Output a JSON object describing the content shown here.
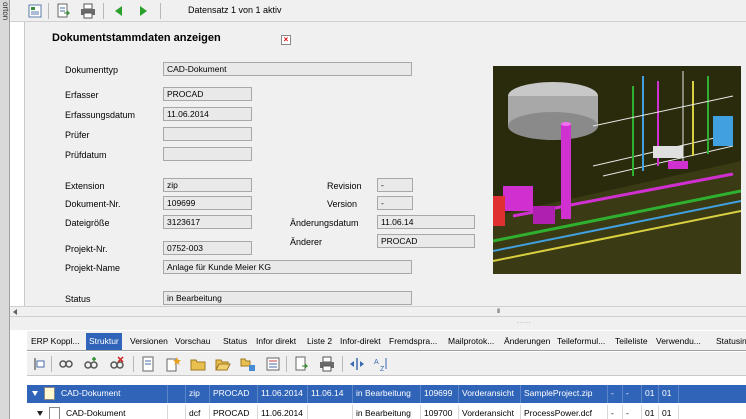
{
  "side_strip": {
    "label": "orton"
  },
  "toolbar": {
    "record_status": "Datensatz 1 von 1 aktiv",
    "icons": [
      "form-view-icon",
      "export-icon",
      "print-icon",
      "back-arrow-icon",
      "forward-arrow-icon"
    ]
  },
  "form": {
    "title": "Dokumentstammdaten anzeigen",
    "close_symbol": "×",
    "fields": {
      "dokumenttyp": {
        "label": "Dokumenttyp",
        "value": "CAD-Dokument"
      },
      "erfasser": {
        "label": "Erfasser",
        "value": "PROCAD"
      },
      "erfassungsdatum": {
        "label": "Erfassungsdatum",
        "value": "11.06.2014"
      },
      "pruefer": {
        "label": "Prüfer",
        "value": ""
      },
      "pruefdatum": {
        "label": "Prüfdatum",
        "value": ""
      },
      "extension": {
        "label": "Extension",
        "value": "zip"
      },
      "dokument_nr": {
        "label": "Dokument-Nr.",
        "value": "109699"
      },
      "dateigroesse": {
        "label": "Dateigröße",
        "value": "3123617"
      },
      "projekt_nr": {
        "label": "Projekt-Nr.",
        "value": "0752-003"
      },
      "projekt_name": {
        "label": "Projekt-Name",
        "value": "Anlage für Kunde Meier KG"
      },
      "status": {
        "label": "Status",
        "value": "in Bearbeitung"
      },
      "revision": {
        "label": "Revision",
        "value": "-"
      },
      "version": {
        "label": "Version",
        "value": "-"
      },
      "aenderungsdatum": {
        "label": "Änderungsdatum",
        "value": "11.06.14"
      },
      "aenderer": {
        "label": "Änderer",
        "value": "PROCAD"
      }
    }
  },
  "scroll": {
    "grip": "III",
    "splitter": "....."
  },
  "tabs": [
    {
      "label": "ERP Koppl...",
      "active": false
    },
    {
      "label": "Struktur",
      "active": true
    },
    {
      "label": "Versionen",
      "active": false
    },
    {
      "label": "Vorschau",
      "active": false
    },
    {
      "label": "Status",
      "active": false
    },
    {
      "label": "Infor direkt",
      "active": false
    },
    {
      "label": "Liste 2",
      "active": false
    },
    {
      "label": "Infor-direkt",
      "active": false
    },
    {
      "label": "Fremdspra...",
      "active": false
    },
    {
      "label": "Mailprotok...",
      "active": false
    },
    {
      "label": "Änderungen",
      "active": false
    },
    {
      "label": "Teileformul...",
      "active": false
    },
    {
      "label": "Teileliste",
      "active": false
    },
    {
      "label": "Verwendu...",
      "active": false
    },
    {
      "label": "Statusin",
      "active": false
    }
  ],
  "grid": {
    "rows": [
      {
        "name": "CAD-Dokument",
        "cells": [
          "",
          "zip",
          "PROCAD",
          "11.06.2014",
          "11.06.14",
          "in Bearbeitung",
          "109699",
          "Vorderansicht",
          "SampleProject.zip",
          "-",
          "-",
          "01",
          "01"
        ],
        "selected": true
      },
      {
        "name": "CAD-Dokument",
        "cells": [
          "",
          "dcf",
          "PROCAD",
          "11.06.2014",
          "",
          "in Bearbeitung",
          "109700",
          "Vorderansicht",
          "ProcessPower.dcf",
          "-",
          "-",
          "01",
          "01"
        ],
        "selected": false
      }
    ]
  },
  "colors": {
    "accent": "#2f64b8",
    "panel_bg": "#f0f0f0",
    "field_bg": "#e9e9e9",
    "preview_bg": "#2a2a0c"
  }
}
